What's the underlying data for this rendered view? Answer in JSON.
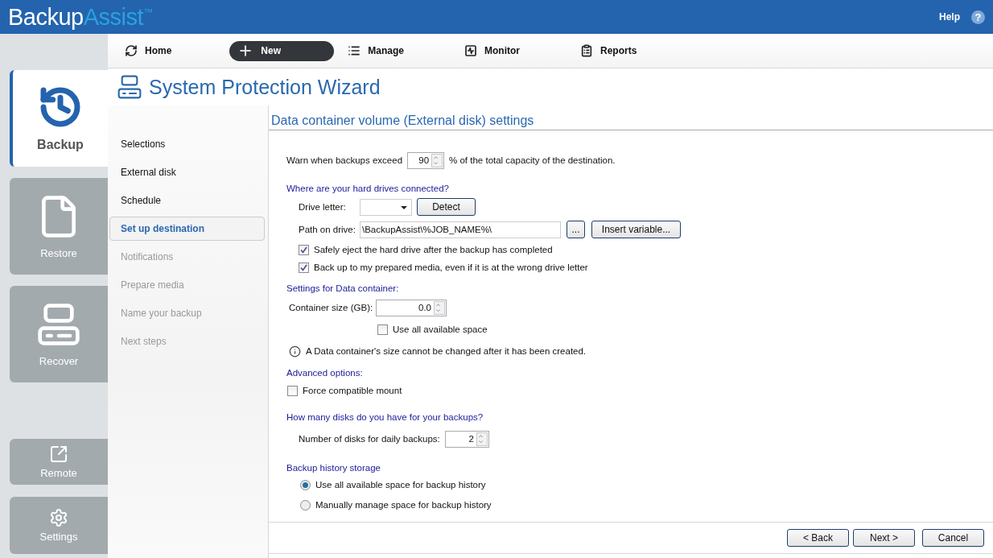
{
  "header": {
    "logo": {
      "primary": "Backup",
      "secondary": "Assist",
      "mark": "™"
    },
    "help": "Help",
    "help_icon": "?"
  },
  "nav": [
    {
      "label": "Home",
      "selected": false
    },
    {
      "label": "New",
      "selected": true
    },
    {
      "label": "Manage",
      "selected": false
    },
    {
      "label": "Monitor",
      "selected": false
    },
    {
      "label": "Reports",
      "selected": false
    }
  ],
  "sidebar": {
    "main_tabs": [
      {
        "label": "Backup",
        "selected": true
      },
      {
        "label": "Restore",
        "selected": false
      },
      {
        "label": "Recover",
        "selected": false
      }
    ],
    "bottom_tabs": [
      {
        "label": "Remote",
        "selected": false
      },
      {
        "label": "Settings",
        "selected": false
      }
    ]
  },
  "wizard": {
    "title": "System Protection Wizard",
    "steps": [
      {
        "label": "Selections",
        "selected": false,
        "disabled": false
      },
      {
        "label": "External disk",
        "selected": false,
        "disabled": false
      },
      {
        "label": "Schedule",
        "selected": false,
        "disabled": false
      },
      {
        "label": "Set up destination",
        "selected": true,
        "disabled": false
      },
      {
        "label": "Notifications",
        "selected": false,
        "disabled": true
      },
      {
        "label": "Prepare media",
        "selected": false,
        "disabled": true
      },
      {
        "label": "Name your backup",
        "selected": false,
        "disabled": true
      },
      {
        "label": "Next steps",
        "selected": false,
        "disabled": true
      }
    ]
  },
  "page": {
    "title": "Data container volume (External disk) settings",
    "warn": {
      "label": "Warn when backups exceed",
      "value": "90",
      "suffix": "% of the total capacity of the destination."
    },
    "drives": {
      "heading": "Where are your hard drives connected?",
      "drive_label": "Drive letter:",
      "detect": "Detect",
      "path_label": "Path on drive:",
      "path_value": "\\BackupAssist\\%JOB_NAME%\\",
      "browse": "...",
      "insert": "Insert variable...",
      "options": [
        {
          "label": "Safely eject the hard drive after the backup has completed",
          "checked": true
        },
        {
          "label": "Back up to my prepared media, even if it is at the wrong drive letter",
          "checked": true
        }
      ]
    },
    "container": {
      "heading": "Settings for Data container:",
      "size_label": "Container size (GB):",
      "size_value": "0.0",
      "use_all": {
        "label": "Use all available space",
        "checked": false
      },
      "note": "A Data container's size cannot be changed after it has been created."
    },
    "advanced": {
      "heading": "Advanced options:",
      "option": {
        "label": "Force compatible mount",
        "checked": false
      }
    },
    "disks": {
      "heading": "How many disks do you have for your backups?",
      "label": "Number of disks for daily backups:",
      "value": "2"
    },
    "history": {
      "heading": "Backup history storage",
      "options": [
        {
          "label": "Use all available space for backup history",
          "selected": true
        },
        {
          "label": "Manually manage space for backup history",
          "selected": false
        }
      ]
    }
  },
  "footer": {
    "buttons": [
      "< Back",
      "Next >",
      "Cancel"
    ]
  }
}
